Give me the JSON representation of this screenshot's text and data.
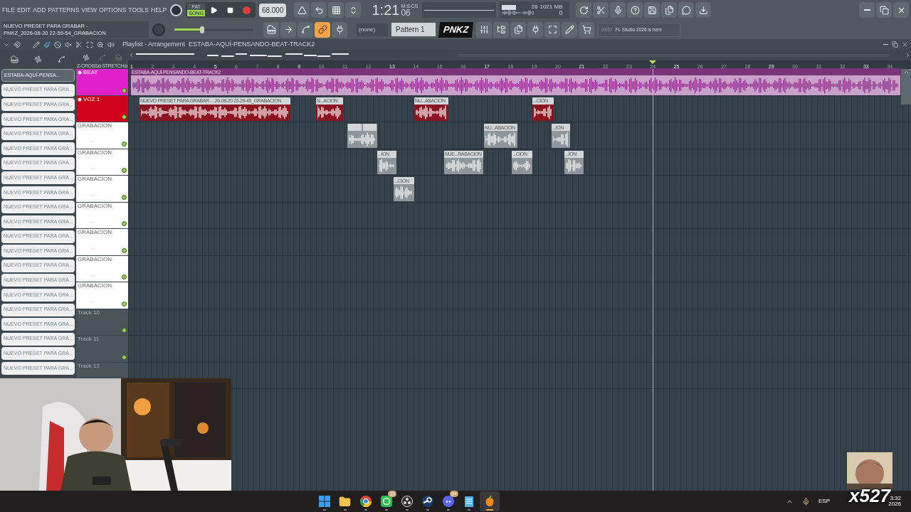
{
  "menu": [
    "FILE",
    "EDIT",
    "ADD",
    "PATTERNS",
    "VIEW",
    "OPTIONS",
    "TOOLS",
    "HELP"
  ],
  "hint": {
    "line1": "NUEVO PRESET PARA GRABAR -",
    "line2": "PNKZ_2026-08-20 22-59-54_GRABACION"
  },
  "transport": {
    "modes": [
      {
        "label": "PAT",
        "selected": false
      },
      {
        "label": "SONG",
        "selected": true
      }
    ],
    "recording": true,
    "tempo": "68.000"
  },
  "time": {
    "value": "1:21",
    "sub": "06",
    "unit": "M:S:CS"
  },
  "monitor": {
    "cpu": "28",
    "memory": "1021 MB",
    "polyphony": "0"
  },
  "master_volume": {
    "level": 0.35
  },
  "pattern": {
    "channel_filter": "(none)",
    "name": "Pattern 1"
  },
  "overlay_logo": "PNKZ",
  "news": {
    "date": "09/07",
    "text": "FL Studio 2026 is here"
  },
  "playlist": {
    "title": "Playlist - Arrangement",
    "arrangement": "ESTABA-AQUÍ-PENSANDO-BEAT-TRACK2",
    "options": [
      {
        "label": "Z-CROSS",
        "checked": false
      },
      {
        "label": "STRETCH",
        "checked": false
      }
    ],
    "ruler": [
      "1",
      "2",
      "3",
      "4",
      "5",
      "6",
      "7",
      "8",
      "9",
      "10",
      "11",
      "12",
      "13",
      "14",
      "15",
      "16",
      "17",
      "18",
      "19",
      "20",
      "21",
      "22",
      "23",
      "24",
      "25",
      "26",
      "27",
      "28",
      "29",
      "30",
      "31",
      "32",
      "33",
      "34"
    ]
  },
  "browser": [
    {
      "name": "ESTABA-AQUÍ-PENSA...",
      "selected": true
    },
    {
      "name": "NUEVO PRESET PARA GRA...",
      "selected": false
    },
    {
      "name": "NUEVO PRESET PARA GRA...",
      "selected": false
    },
    {
      "name": "NUEVO PRESET PARA GRA...",
      "selected": false
    },
    {
      "name": "NUEVO PRESET PARA GRA...",
      "selected": false
    },
    {
      "name": "NUEVO PRESET PARA GRA...",
      "selected": false
    },
    {
      "name": "NUEVO PRESET PARA GRA...",
      "selected": false
    },
    {
      "name": "NUEVO PRESET PARA GRA...",
      "selected": false
    },
    {
      "name": "NUEVO PRESET PARA GRA...",
      "selected": false
    },
    {
      "name": "NUEVO PRESET PARA GRA...",
      "selected": false
    },
    {
      "name": "NUEVO PRESET PARA GRA...",
      "selected": false
    },
    {
      "name": "NUEVO PRESET PARA GRA...",
      "selected": false
    },
    {
      "name": "NUEVO PRESET PARA GRA...",
      "selected": false
    },
    {
      "name": "NUEVO PRESET PARA GRA...",
      "selected": false
    },
    {
      "name": "NUEVO PRESET PARA GRA...",
      "selected": false
    },
    {
      "name": "NUEVO PRESET PARA GRA...",
      "selected": false
    },
    {
      "name": "NUEVO PRESET PARA GRA...",
      "selected": false
    },
    {
      "name": "NUEVO PRESET PARA GRA...",
      "selected": false
    },
    {
      "name": "NUEVO PRESET PARA GRA...",
      "selected": false
    },
    {
      "name": "NUEVO PRESET PARA GRA...",
      "selected": false
    },
    {
      "name": "NUEVO PRESET PARA GRA...",
      "selected": false
    }
  ],
  "tracks": [
    {
      "name": "BEAT",
      "kind": "beat",
      "color": "#e020c8",
      "enabled": true,
      "clips": [
        {
          "label": "ESTABA-AQUÍ-PENSANDO-BEAT-TRACK2"
        }
      ]
    },
    {
      "name": "VOZ 1",
      "kind": "voice",
      "color": "#d0021b",
      "enabled": true,
      "clips": [
        {
          "label": "NUEVO PRESET PARA GRABAR - ..26-08-20 22-29-45_GRABACION"
        },
        {
          "label": "N...ACION"
        },
        {
          "label": "NU...ABACION"
        },
        {
          "label": "...CION"
        }
      ]
    },
    {
      "name": "GRABACION",
      "kind": "take",
      "note": "...",
      "color": "#ffffff",
      "enabled": true,
      "clips": [
        {
          "split": true
        },
        {
          "label": "NU...ABACION"
        },
        {
          "label": "...ION"
        }
      ]
    },
    {
      "name": "GRABACION",
      "kind": "take",
      "note": "...",
      "color": "#ffffff",
      "enabled": true,
      "clips": [
        {
          "label": "...ION"
        },
        {
          "label": "NUE...RABACION"
        },
        {
          "label": "...CION"
        },
        {
          "label": "...ION"
        }
      ]
    },
    {
      "name": "GRABACION",
      "kind": "take",
      "note": "...",
      "color": "#ffffff",
      "enabled": true,
      "clips": [
        {
          "label": "...CION"
        }
      ]
    },
    {
      "name": "GRABACION",
      "kind": "take",
      "note": "...",
      "color": "#ffffff",
      "enabled": true
    },
    {
      "name": "GRABACION",
      "kind": "take",
      "note": "...",
      "color": "#ffffff",
      "enabled": true
    },
    {
      "name": "GRABACION",
      "kind": "take",
      "note": "...",
      "color": "#ffffff",
      "enabled": true
    },
    {
      "name": "GRABACION",
      "kind": "take",
      "note": "...",
      "color": "#ffffff",
      "enabled": true
    },
    {
      "name": "Track 10",
      "kind": "empty",
      "enabled": true
    },
    {
      "name": "Track 11",
      "kind": "empty",
      "enabled": true
    },
    {
      "name": "Track 12",
      "kind": "empty"
    }
  ],
  "taskbar": {
    "apps": [
      {
        "kind": "start",
        "selected": false
      },
      {
        "kind": "folder",
        "selected": false
      },
      {
        "kind": "browser",
        "selected": false
      },
      {
        "kind": "chat",
        "badge": "33",
        "selected": false
      },
      {
        "kind": "recorder",
        "selected": false
      },
      {
        "kind": "game",
        "selected": false
      },
      {
        "kind": "voice",
        "badge": "9+",
        "selected": false
      },
      {
        "kind": "notes",
        "selected": false
      },
      {
        "kind": "daw",
        "selected": true
      }
    ],
    "language": "ESP",
    "time": "3:32",
    "date": "2026"
  },
  "stream_overlay": {
    "text": "x527"
  }
}
